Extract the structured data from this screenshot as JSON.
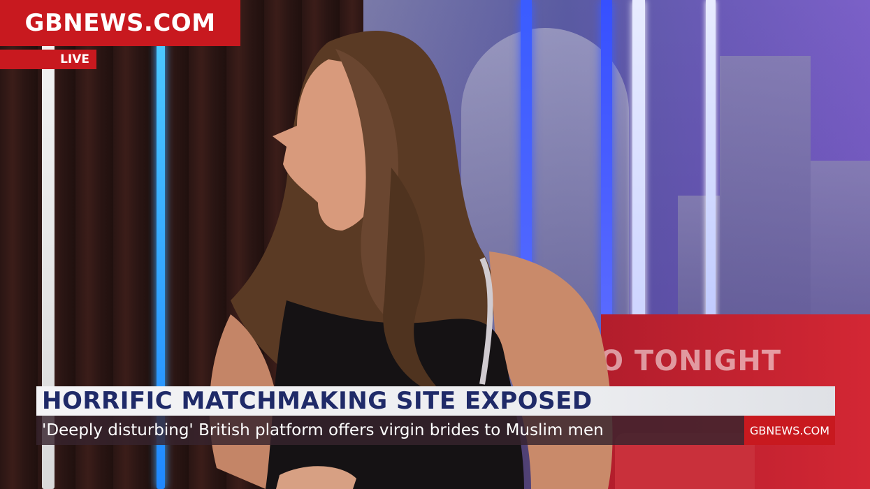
{
  "channel": {
    "logo_text": "GBNEWS.COM",
    "live_label": "LIVE",
    "brand_color": "#c8191f"
  },
  "studio": {
    "sign_text": "O TONIGHT"
  },
  "lower_third": {
    "headline": "HORRIFIC MATCHMAKING SITE EXPOSED",
    "subheadline": "'Deeply disturbing' British platform offers virgin brides to Muslim men",
    "corner_logo": "GBNEWS.COM",
    "headline_color": "#1f2a68"
  }
}
